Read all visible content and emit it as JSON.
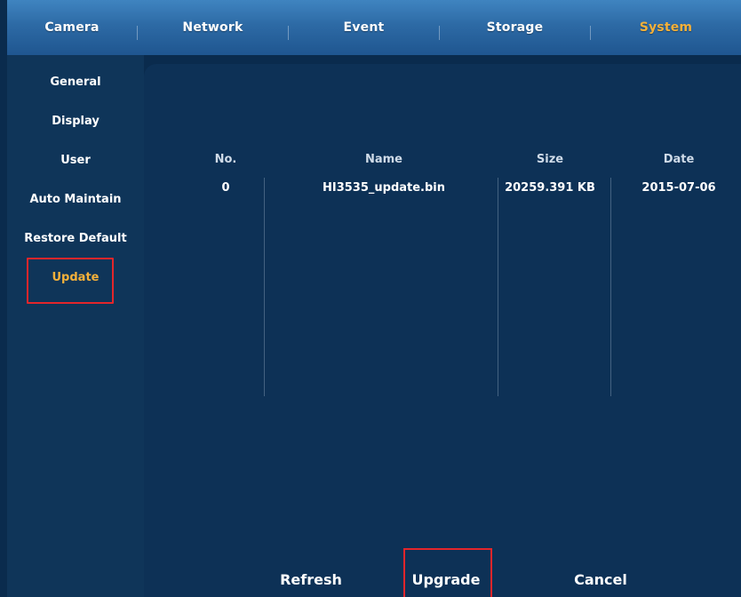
{
  "topnav": {
    "tabs": [
      {
        "label": "Camera"
      },
      {
        "label": "Network"
      },
      {
        "label": "Event"
      },
      {
        "label": "Storage"
      },
      {
        "label": "System",
        "active": true
      }
    ]
  },
  "sidebar": {
    "items": [
      {
        "label": "General"
      },
      {
        "label": "Display"
      },
      {
        "label": "User"
      },
      {
        "label": "Auto Maintain"
      },
      {
        "label": "Restore Default"
      },
      {
        "label": "Update",
        "active": true
      }
    ]
  },
  "table": {
    "headers": {
      "no": "No.",
      "name": "Name",
      "size": "Size",
      "date": "Date"
    },
    "rows": [
      {
        "no": "0",
        "name": "HI3535_update.bin",
        "size": "20259.391 KB",
        "date": "2015-07-06"
      }
    ]
  },
  "actions": {
    "refresh": "Refresh",
    "upgrade": "Upgrade",
    "cancel": "Cancel"
  },
  "colors": {
    "accent": "#f4b13a",
    "highlight_box": "#e3262b",
    "panel": "#0d3156",
    "topnav": "#2d6aa5"
  }
}
